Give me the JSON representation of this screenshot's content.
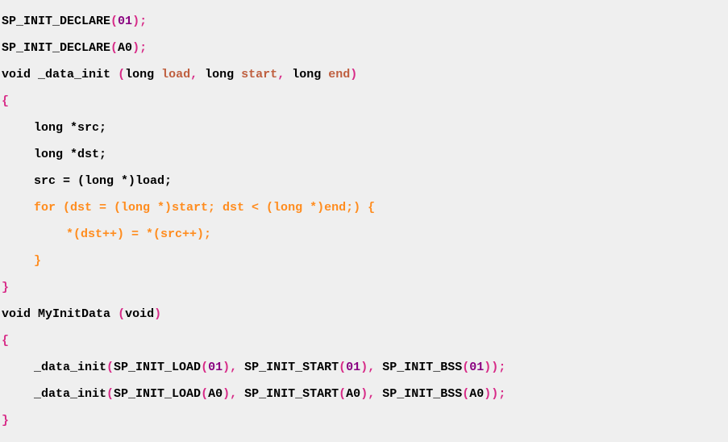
{
  "code": {
    "l1": {
      "macro": "SP_INIT_DECLARE",
      "arg": "01"
    },
    "l2": {
      "macro": "SP_INIT_DECLARE",
      "arg": "A0"
    },
    "l3": {
      "ret": "void",
      "name": "_data_init",
      "p1t": "long",
      "p1n": "load",
      "p2t": "long",
      "p2n": "start",
      "p3t": "long",
      "p3n": "end"
    },
    "l5": {
      "type": "long",
      "rest": " *src;"
    },
    "l6": {
      "type": "long",
      "rest": " *dst;"
    },
    "l7": {
      "text": "src = (long *)load;"
    },
    "l8": {
      "kw": "for",
      "body": " (dst = (long *)start; dst < (long *)end;) {"
    },
    "l9": {
      "text": "*(dst++) = *(src++);"
    },
    "l10": {
      "brace": "}"
    },
    "l12": {
      "ret": "void",
      "name": "MyInitData",
      "paramsPrefix": "void"
    },
    "l14": {
      "fn": "_data_init",
      "m1": "SP_INIT_LOAD",
      "a1": "01",
      "m2": "SP_INIT_START",
      "a2": "01",
      "m3": "SP_INIT_BSS",
      "a3": "01"
    },
    "l15": {
      "fn": "_data_init",
      "m1": "SP_INIT_LOAD",
      "a1": "A0",
      "m2": "SP_INIT_START",
      "a2": "A0",
      "m3": "SP_INIT_BSS",
      "a3": "A0"
    },
    "braceOpen": "{",
    "braceClose": "}",
    "parenOpen": "(",
    "parenClose": ")",
    "semi": ";",
    "comma": ", "
  }
}
